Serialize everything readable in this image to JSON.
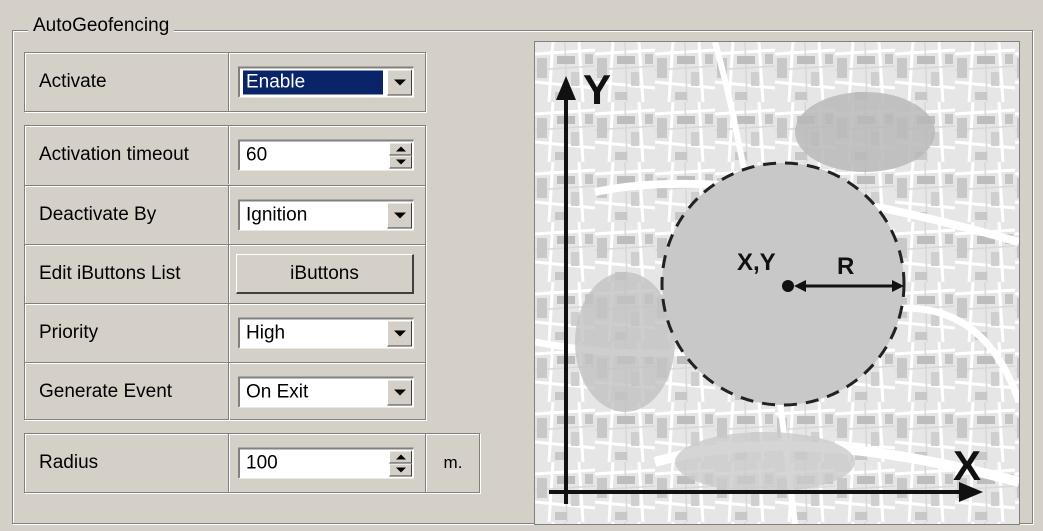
{
  "group": {
    "title": "AutoGeofencing"
  },
  "activate": {
    "label": "Activate",
    "value": "Enable"
  },
  "activation_timeout": {
    "label": "Activation timeout",
    "value": "60"
  },
  "deactivate_by": {
    "label": "Deactivate By",
    "value": "Ignition"
  },
  "ibuttons": {
    "label": "Edit iButtons List",
    "button_label": "iButtons"
  },
  "priority": {
    "label": "Priority",
    "value": "High"
  },
  "generate_event": {
    "label": "Generate Event",
    "value": "On Exit"
  },
  "radius": {
    "label": "Radius",
    "value": "100",
    "unit": "m."
  },
  "diagram": {
    "y_axis_label": "Y",
    "x_axis_label": "X",
    "center_label": "X,Y",
    "radius_label": "R"
  },
  "colors": {
    "panel_bg": "#d4d0c8",
    "selection_bg": "#0a246a",
    "map_gray": "#c8c8c8"
  }
}
